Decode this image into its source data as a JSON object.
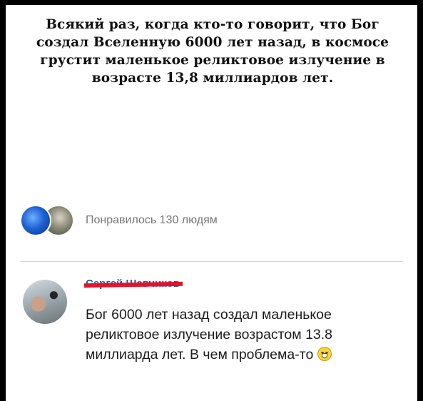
{
  "post": {
    "text": "Всякий раз, когда кто-то говорит, что Бог создал Вселенную 6000 лет назад, в космосе грустит маленькое реликтовое излучение в возрасте 13,8 миллиардов лет."
  },
  "reactions": {
    "likes_text": "Понравилось 130 людям"
  },
  "comment": {
    "author": "Сергей Шевчиков",
    "text": "Бог 6000 лет назад создал маленькое реликтовое излучение возрастом 13.8 миллиарда лет. В чем проблема-то",
    "emoji": "grinning-face-emoji"
  }
}
